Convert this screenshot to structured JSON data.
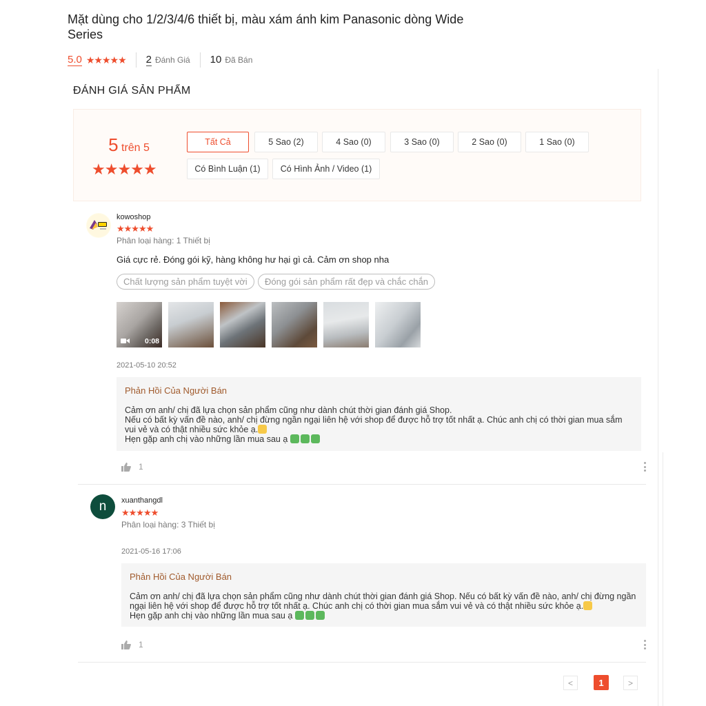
{
  "product": {
    "title": "Mặt dùng cho 1/2/3/4/6 thiết bị, màu xám ánh kim Panasonic dòng Wide Series",
    "rating": "5.0",
    "stars": "★★★★★",
    "review_count": "2",
    "review_label": "Đánh Giá",
    "sold_count": "10",
    "sold_label": "Đã Bán"
  },
  "ratings_section": {
    "title": "ĐÁNH GIÁ SẢN PHẨM",
    "score": "5",
    "score_suffix": "trên 5",
    "stars": "★★★★★",
    "filters": [
      "Tất Cả",
      "5 Sao (2)",
      "4 Sao (0)",
      "3 Sao (0)",
      "2 Sao (0)",
      "1 Sao (0)",
      "Có Bình Luận (1)",
      "Có Hình Ảnh / Video (1)"
    ]
  },
  "reviews": [
    {
      "username": "kowoshop",
      "stars": "★★★★★",
      "variation": "Phân loại hàng: 1 Thiết bị",
      "comment": "Giá cực rẻ. Đóng gói kỹ, hàng không hư hại gì cả. Cảm ơn shop nha",
      "tags": [
        "Chất lượng sản phẩm tuyệt vời",
        "Đóng gói sản phẩm rất đẹp và chắc chắn"
      ],
      "video_duration": "0:08",
      "time": "2021-05-10 20:52",
      "seller_title": "Phản Hồi Của Người Bán",
      "seller_reply": "Cảm ơn anh/ chị đã lựa chọn sản phẩm cũng như dành chút thời gian đánh giá Shop.\nNếu có bất kỳ vấn đề nào, anh/ chị đừng ngần ngại liên hệ với shop để được hỗ trợ tốt nhất ạ. Chúc anh chị có thời gian mua sắm vui vẻ và có thật nhiều sức khỏe ạ.",
      "seller_reply_end": "Hẹn gặp anh chị vào những lần mua sau ạ",
      "likes": "1"
    },
    {
      "username": "xuanthangdl",
      "avatar_letter": "n",
      "stars": "★★★★★",
      "variation": "Phân loại hàng: 3 Thiết bị",
      "time": "2021-05-16 17:06",
      "seller_title": "Phản Hồi Của Người Bán",
      "seller_reply": "Cảm ơn anh/ chị đã lựa chọn sản phẩm cũng như dành chút thời gian đánh giá Shop. Nếu có bất kỳ vấn đề nào, anh/ chị đừng ngần ngại liên hệ với shop để được hỗ trợ tốt nhất ạ. Chúc anh chị có thời gian mua sắm vui vẻ và có thật nhiều sức khỏe ạ.",
      "seller_reply_end": "Hẹn gặp anh chị vào những lần mua sau ạ",
      "likes": "1"
    }
  ],
  "pagination": {
    "prev": "<",
    "current": "1",
    "next": ">"
  },
  "colors": {
    "accent": "#ee4d2d",
    "seller_title": "#a05a2c",
    "avatar_green": "#0e4d3c"
  },
  "icons": [
    "star-icon",
    "thumbs-up-icon",
    "more-vertical-icon",
    "video-camera-icon",
    "chevron-left-icon",
    "chevron-right-icon"
  ]
}
